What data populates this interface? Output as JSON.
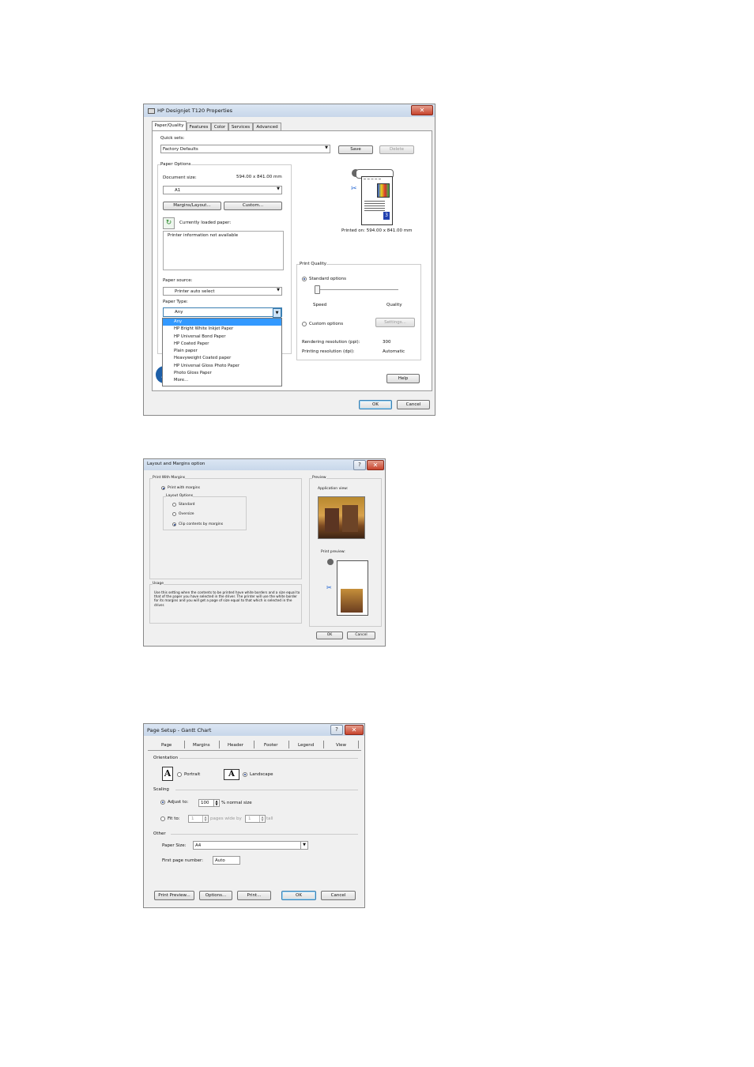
{
  "dialog1": {
    "title": "HP Designjet T120 Properties",
    "tabs": [
      "Paper/Quality",
      "Features",
      "Color",
      "Services",
      "Advanced"
    ],
    "quick_sets_label": "Quick sets:",
    "quick_sets_value": "Factory Defaults",
    "save_label": "Save",
    "delete_label": "Delete",
    "paper_options_label": "Paper Options",
    "document_size_label": "Document size:",
    "document_size_value": "594.00 x 841.00 mm",
    "size_select": "A1",
    "margins_button": "Margins/Layout...",
    "custom_button": "Custom...",
    "loaded_paper_label": "Currently loaded paper:",
    "printer_info": "Printer information not available",
    "paper_source_label": "Paper source:",
    "paper_source_value": "Printer auto select",
    "paper_type_label": "Paper Type:",
    "paper_type_value": "Any",
    "paper_type_options": [
      "Any",
      "HP Bright White Inkjet Paper",
      "HP Universal Bond Paper",
      "HP Coated Paper",
      "Plain paper",
      "Heavyweight Coated paper",
      "HP Universal Gloss Photo Paper",
      "Photo Gloss Paper",
      "More..."
    ],
    "printed_on": "Printed on: 594.00 x 841.00 mm",
    "print_quality_label": "Print Quality",
    "standard_options": "Standard options",
    "speed_label": "Speed",
    "quality_label": "Quality",
    "custom_options": "Custom options",
    "settings_button": "Settings...",
    "rendering_label": "Rendering resolution (ppi):",
    "rendering_value": "300",
    "printing_label": "Printing resolution (dpi):",
    "printing_value": "Automatic",
    "help_button": "Help",
    "ok_button": "OK",
    "cancel_button": "Cancel"
  },
  "dialog2": {
    "title": "Layout and Margins option",
    "print_with_margins_label": "Print With Margins",
    "print_with_margins_option": "Print with margins",
    "layout_options_label": "Layout Options",
    "standard": "Standard",
    "oversize": "Oversize",
    "clip": "Clip contents by margins",
    "preview_label": "Preview",
    "application_view": "Application view:",
    "print_preview": "Print preview:",
    "usage_label": "Usage",
    "usage_text": "Use this setting when the contents to be printed have white borders and a size equal to that of the paper you have selected in the driver. The printer will use the white border for its margins and you will get a page of size equal to that which is selected in the driver.",
    "ok_button": "OK",
    "cancel_button": "Cancel"
  },
  "dialog3": {
    "title": "Page Setup - Gantt Chart",
    "tabs": [
      "Page",
      "Margins",
      "Header",
      "Footer",
      "Legend",
      "View"
    ],
    "orientation_label": "Orientation",
    "portrait": "Portrait",
    "landscape": "Landscape",
    "scaling_label": "Scaling",
    "adjust_to": "Adjust to:",
    "adjust_value": "100",
    "normal_size": "% normal size",
    "fit_to": "Fit to:",
    "fit_wide_value": "1",
    "pages_wide_by": "pages wide by",
    "fit_tall_value": "1",
    "tall": "tall",
    "other_label": "Other",
    "paper_size_label": "Paper Size:",
    "paper_size_value": "A4",
    "first_page_label": "First page number:",
    "first_page_value": "Auto",
    "print_preview_button": "Print Preview...",
    "options_button": "Options...",
    "print_button": "Print...",
    "ok_button": "OK",
    "cancel_button": "Cancel"
  }
}
